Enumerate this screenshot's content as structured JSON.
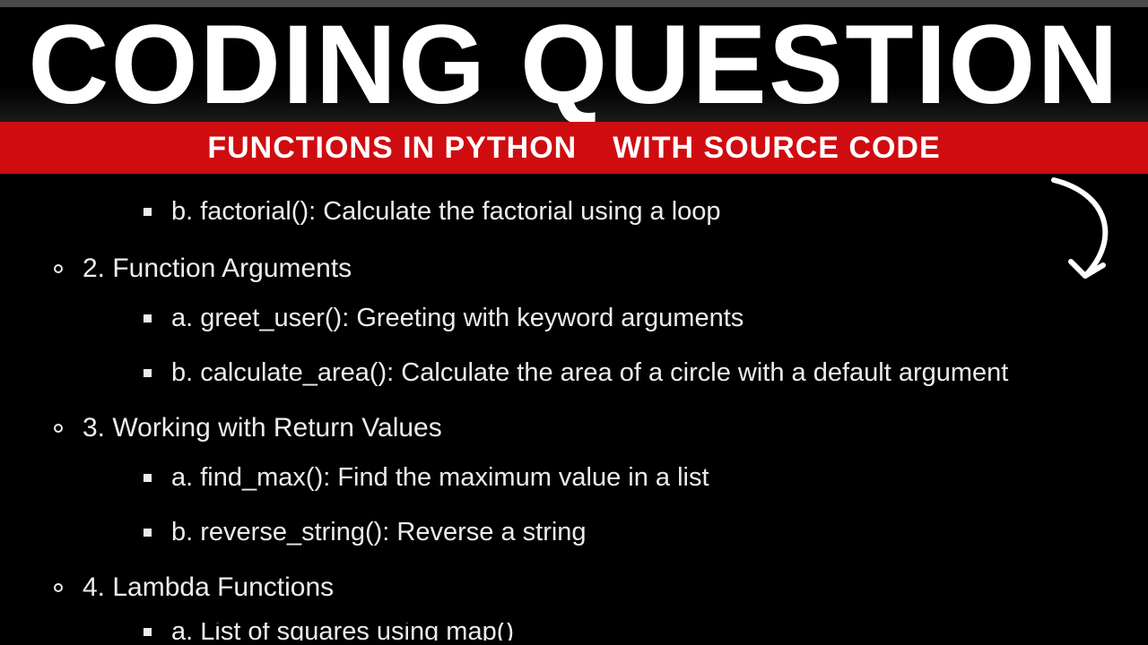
{
  "header": {
    "title": "CODING QUESTION",
    "subtitle_left": "FUNCTIONS IN PYTHON",
    "subtitle_right": "WITH SOURCE CODE"
  },
  "orphan_item": "b. factorial(): Calculate the factorial using a loop",
  "sections": [
    {
      "heading": "2. Function Arguments",
      "items": [
        "a. greet_user(): Greeting with keyword arguments",
        "b. calculate_area(): Calculate the area of a circle with a default argument"
      ]
    },
    {
      "heading": "3. Working with Return Values",
      "items": [
        "a. find_max(): Find the maximum value in a list",
        "b. reverse_string(): Reverse a string"
      ]
    },
    {
      "heading": "4. Lambda Functions",
      "items": [
        "a. List of squares using map()"
      ]
    }
  ]
}
